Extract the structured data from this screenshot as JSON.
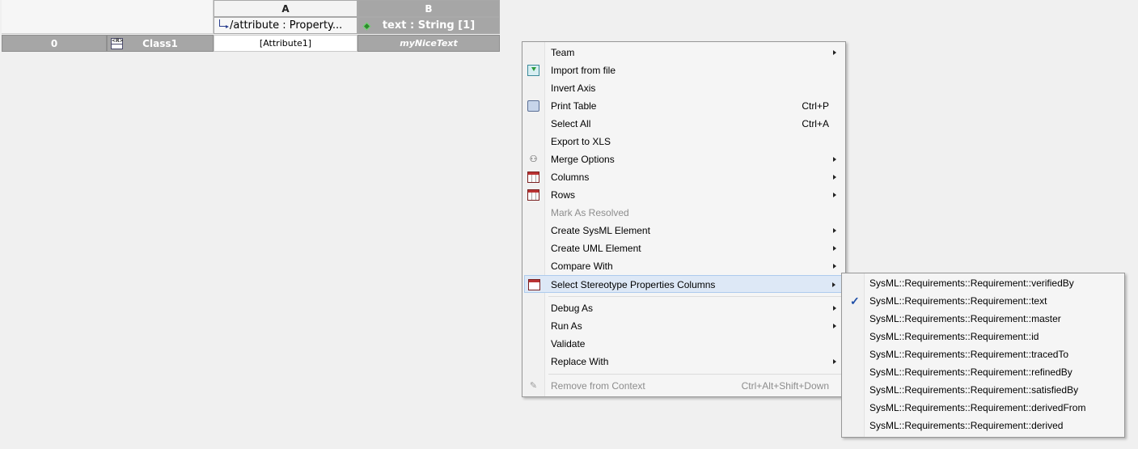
{
  "table": {
    "columns": [
      {
        "letter": "A",
        "title": "/attribute : Property..."
      },
      {
        "letter": "B",
        "title": "text : String [1]"
      }
    ],
    "row": {
      "number": "0",
      "element": "Class1",
      "col_a": "[Attribute1]",
      "col_b": "myNiceText"
    }
  },
  "context_menu": {
    "items": [
      {
        "label": "Team",
        "submenu": true,
        "icon": ""
      },
      {
        "label": "Import from file",
        "icon": "import-icon"
      },
      {
        "label": "Invert Axis",
        "icon": ""
      },
      {
        "label": "Print Table",
        "shortcut": "Ctrl+P",
        "icon": "print-icon"
      },
      {
        "label": "Select All",
        "shortcut": "Ctrl+A",
        "icon": ""
      },
      {
        "label": "Export to XLS",
        "icon": ""
      },
      {
        "label": "Merge Options",
        "submenu": true,
        "icon": "merge-icon"
      },
      {
        "label": "Columns",
        "submenu": true,
        "icon": "columns-table-icon"
      },
      {
        "label": "Rows",
        "submenu": true,
        "icon": "rows-table-icon"
      },
      {
        "label": "Mark As Resolved",
        "disabled": true,
        "icon": ""
      },
      {
        "label": "Create SysML Element",
        "submenu": true,
        "icon": ""
      },
      {
        "label": "Create UML Element",
        "submenu": true,
        "icon": ""
      },
      {
        "label": "Compare With",
        "submenu": true,
        "icon": ""
      },
      {
        "label": "Select Stereotype Properties Columns",
        "submenu": true,
        "highlighted": true,
        "icon": "stereotype-table-icon"
      },
      {
        "label": "Debug As",
        "submenu": true,
        "icon": ""
      },
      {
        "label": "Run As",
        "submenu": true,
        "icon": ""
      },
      {
        "label": "Validate",
        "icon": ""
      },
      {
        "label": "Replace With",
        "submenu": true,
        "icon": ""
      },
      {
        "label": "Remove from Context",
        "shortcut": "Ctrl+Alt+Shift+Down",
        "disabled": true,
        "icon": "remove-icon"
      }
    ]
  },
  "stereotype_submenu": {
    "items": [
      {
        "label": "SysML::Requirements::Requirement::verifiedBy",
        "checked": false
      },
      {
        "label": "SysML::Requirements::Requirement::text",
        "checked": true
      },
      {
        "label": "SysML::Requirements::Requirement::master",
        "checked": false
      },
      {
        "label": "SysML::Requirements::Requirement::id",
        "checked": false
      },
      {
        "label": "SysML::Requirements::Requirement::tracedTo",
        "checked": false
      },
      {
        "label": "SysML::Requirements::Requirement::refinedBy",
        "checked": false
      },
      {
        "label": "SysML::Requirements::Requirement::satisfiedBy",
        "checked": false
      },
      {
        "label": "SysML::Requirements::Requirement::derivedFrom",
        "checked": false
      },
      {
        "label": "SysML::Requirements::Requirement::derived",
        "checked": false
      }
    ],
    "check_glyph": "✓"
  }
}
